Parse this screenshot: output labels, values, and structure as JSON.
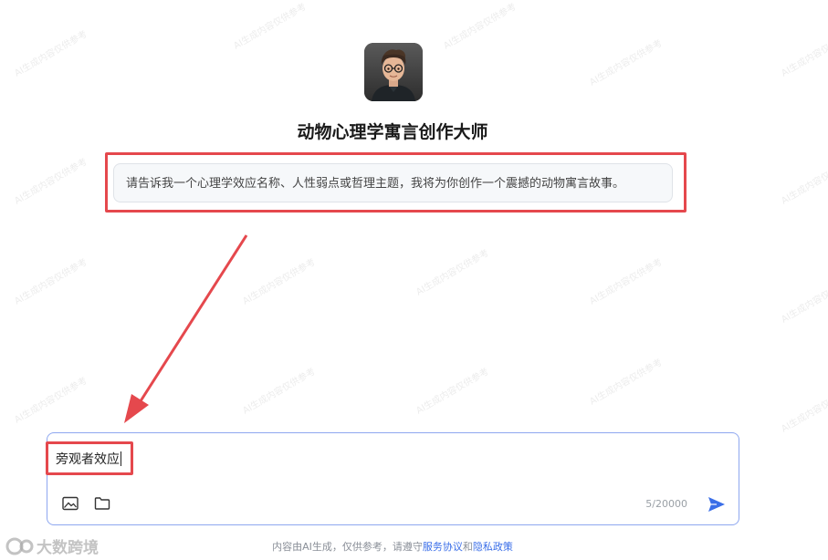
{
  "agent": {
    "avatar": "avatar",
    "title": "动物心理学寓言创作大师",
    "intro": "请告诉我一个心理学效应名称、人性弱点或哲理主题，我将为你创作一个震撼的动物寓言故事。"
  },
  "composer": {
    "value": "旁观者效应",
    "counter": "5/20000",
    "image_icon": "image-icon",
    "folder_icon": "folder-icon",
    "send_icon": "send-icon"
  },
  "footer": {
    "prefix": "内容由AI生成，仅供参考，请遵守",
    "service_link": "服务协议",
    "and": "和",
    "privacy_link": "隐私政策"
  },
  "watermark": {
    "brand": "大数跨境",
    "text": "AI生成内容仅供参考"
  },
  "colors": {
    "annotation_red": "#e5484d",
    "accent_blue": "#3a6ee8",
    "input_border": "#8ea7f0"
  }
}
